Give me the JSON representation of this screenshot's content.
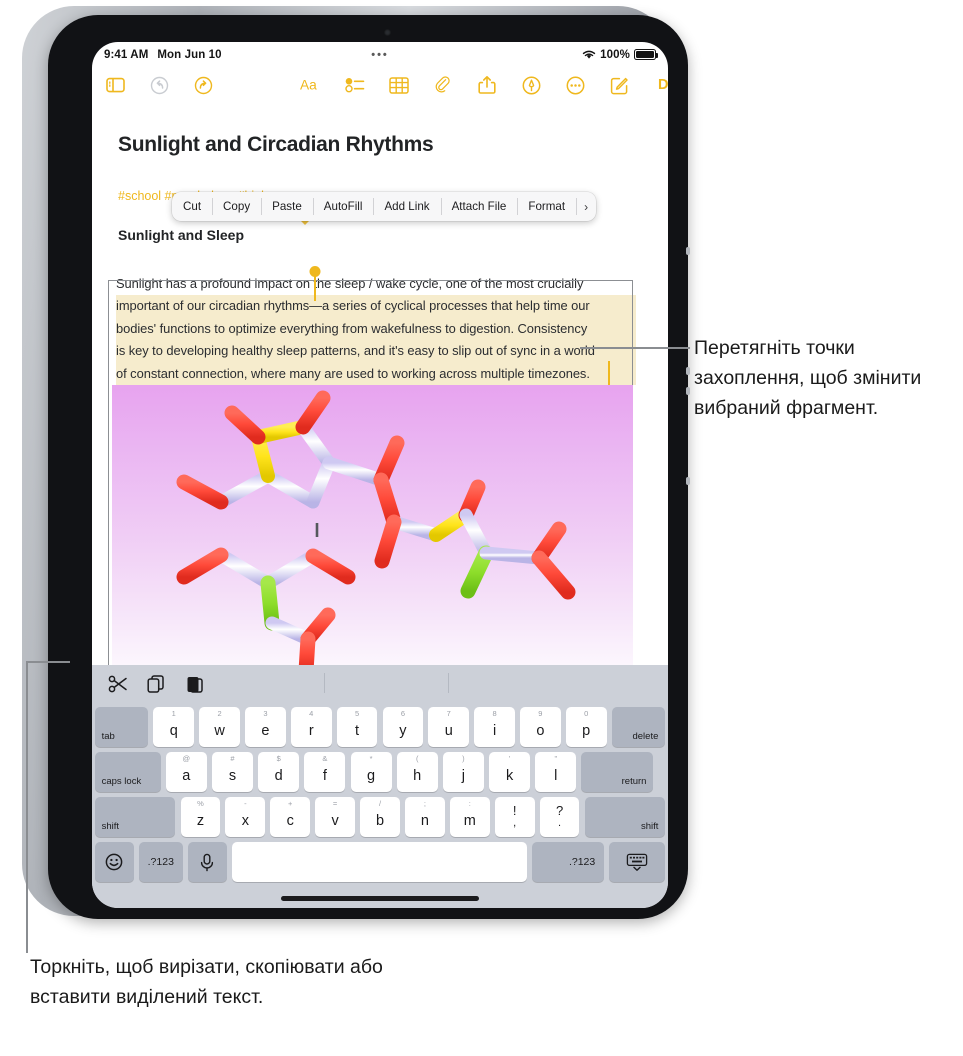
{
  "statusbar": {
    "time": "9:41 AM",
    "date": "Mon Jun 10",
    "center_dots": "•••",
    "battery_percent": "100%",
    "wifi_icon": "wifi-icon",
    "battery_icon": "battery-full-icon"
  },
  "toolbar": {
    "sidebar_icon": "sidebar-icon",
    "undo_icon": "undo-icon",
    "redo_icon": "redo-icon",
    "format_icon": "format-aa-icon",
    "checklist_icon": "checklist-icon",
    "table_icon": "table-icon",
    "attach_icon": "paperclip-icon",
    "share_icon": "share-icon",
    "markup_icon": "markup-pen-icon",
    "more_icon": "more-ellipsis-icon",
    "compose_icon": "compose-icon",
    "done_label": "Done"
  },
  "note": {
    "title": "Sunlight and Circadian Rhythms",
    "tags": "#school #psychology #biology",
    "heading": "Sunlight and Sleep",
    "paragraph_lines": [
      "Sunlight has a profound impact on the sleep / wake cycle, one of the most crucially",
      "important of our circadian rhythms—a series of cyclical processes that help time our",
      "bodies' functions to optimize everything from wakefulness to digestion. Consistency",
      "is key to developing healthy sleep patterns, and it's easy to slip out of sync in a world",
      "of constant connection, where many are used to working across multiple timezones."
    ],
    "image_alt": "molecule-3d-model"
  },
  "edit_menu": {
    "items": [
      "Cut",
      "Copy",
      "Paste",
      "AutoFill",
      "Add Link",
      "Attach File",
      "Format"
    ],
    "more_arrow": "›"
  },
  "shortcut_bar": {
    "cut_icon": "scissors-cut-icon",
    "copy_icon": "copy-icon",
    "paste_icon": "paste-icon"
  },
  "keyboard": {
    "row1": [
      {
        "label": "tab",
        "type": "mod"
      },
      {
        "alt": "1",
        "main": "q"
      },
      {
        "alt": "2",
        "main": "w"
      },
      {
        "alt": "3",
        "main": "e"
      },
      {
        "alt": "4",
        "main": "r"
      },
      {
        "alt": "5",
        "main": "t"
      },
      {
        "alt": "6",
        "main": "y"
      },
      {
        "alt": "7",
        "main": "u"
      },
      {
        "alt": "8",
        "main": "i"
      },
      {
        "alt": "9",
        "main": "o"
      },
      {
        "alt": "0",
        "main": "p"
      },
      {
        "label": "delete",
        "type": "mod"
      }
    ],
    "row2": [
      {
        "label": "caps lock",
        "type": "mod"
      },
      {
        "alt": "@",
        "main": "a"
      },
      {
        "alt": "#",
        "main": "s"
      },
      {
        "alt": "$",
        "main": "d"
      },
      {
        "alt": "&",
        "main": "f"
      },
      {
        "alt": "*",
        "main": "g"
      },
      {
        "alt": "(",
        "main": "h"
      },
      {
        "alt": ")",
        "main": "j"
      },
      {
        "alt": "'",
        "main": "k"
      },
      {
        "alt": "\"",
        "main": "l"
      },
      {
        "label": "return",
        "type": "mod"
      }
    ],
    "row3": [
      {
        "label": "shift",
        "type": "mod"
      },
      {
        "alt": "%",
        "main": "z"
      },
      {
        "alt": "-",
        "main": "x"
      },
      {
        "alt": "+",
        "main": "c"
      },
      {
        "alt": "=",
        "main": "v"
      },
      {
        "alt": "/",
        "main": "b"
      },
      {
        "alt": ";",
        "main": "n"
      },
      {
        "alt": ":",
        "main": "m"
      },
      {
        "up": "!",
        "dn": ",",
        "punc": true
      },
      {
        "up": "?",
        "dn": ".",
        "punc": true
      },
      {
        "label": "shift",
        "type": "mod"
      }
    ],
    "row4": {
      "emoji_icon": "emoji-smiley-icon",
      "numbers_left": ".?123",
      "mic_icon": "microphone-icon",
      "space": "",
      "numbers_right": ".?123",
      "dismiss_icon": "hide-keyboard-icon"
    }
  },
  "callouts": {
    "right": "Перетягніть точки захоплення, щоб змінити вибраний фрагмент.",
    "bottom": "Торкніть, щоб вирізати, скопіювати або вставити виділений текст."
  },
  "colors": {
    "accent": "#efb81e",
    "selection_highlight": "#f6eccd",
    "keyboard_bg": "#ccd0d8",
    "key_mod": "#aeb4c0",
    "image_bg": "#e7a3ef"
  }
}
